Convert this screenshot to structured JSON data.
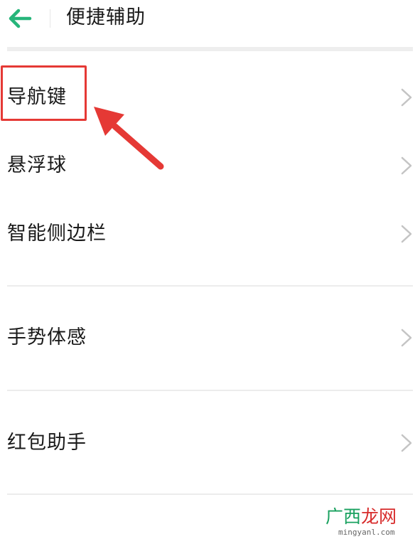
{
  "header": {
    "back_icon": "arrow-left-icon",
    "title": "便捷辅助"
  },
  "colors": {
    "accent": "#26b57a",
    "highlight": "#e53935",
    "chevron": "#c4c4c4"
  },
  "menu": {
    "items": [
      {
        "label": "导航键",
        "icon": "chevron-right-icon"
      },
      {
        "label": "悬浮球",
        "icon": "chevron-right-icon"
      },
      {
        "label": "智能侧边栏",
        "icon": "chevron-right-icon"
      },
      {
        "label": "手势体感",
        "icon": "chevron-right-icon"
      },
      {
        "label": "红包助手",
        "icon": "chevron-right-icon"
      }
    ]
  },
  "watermark": {
    "part1": "广西",
    "part2": "龙网",
    "url": "mingyanl.com"
  }
}
